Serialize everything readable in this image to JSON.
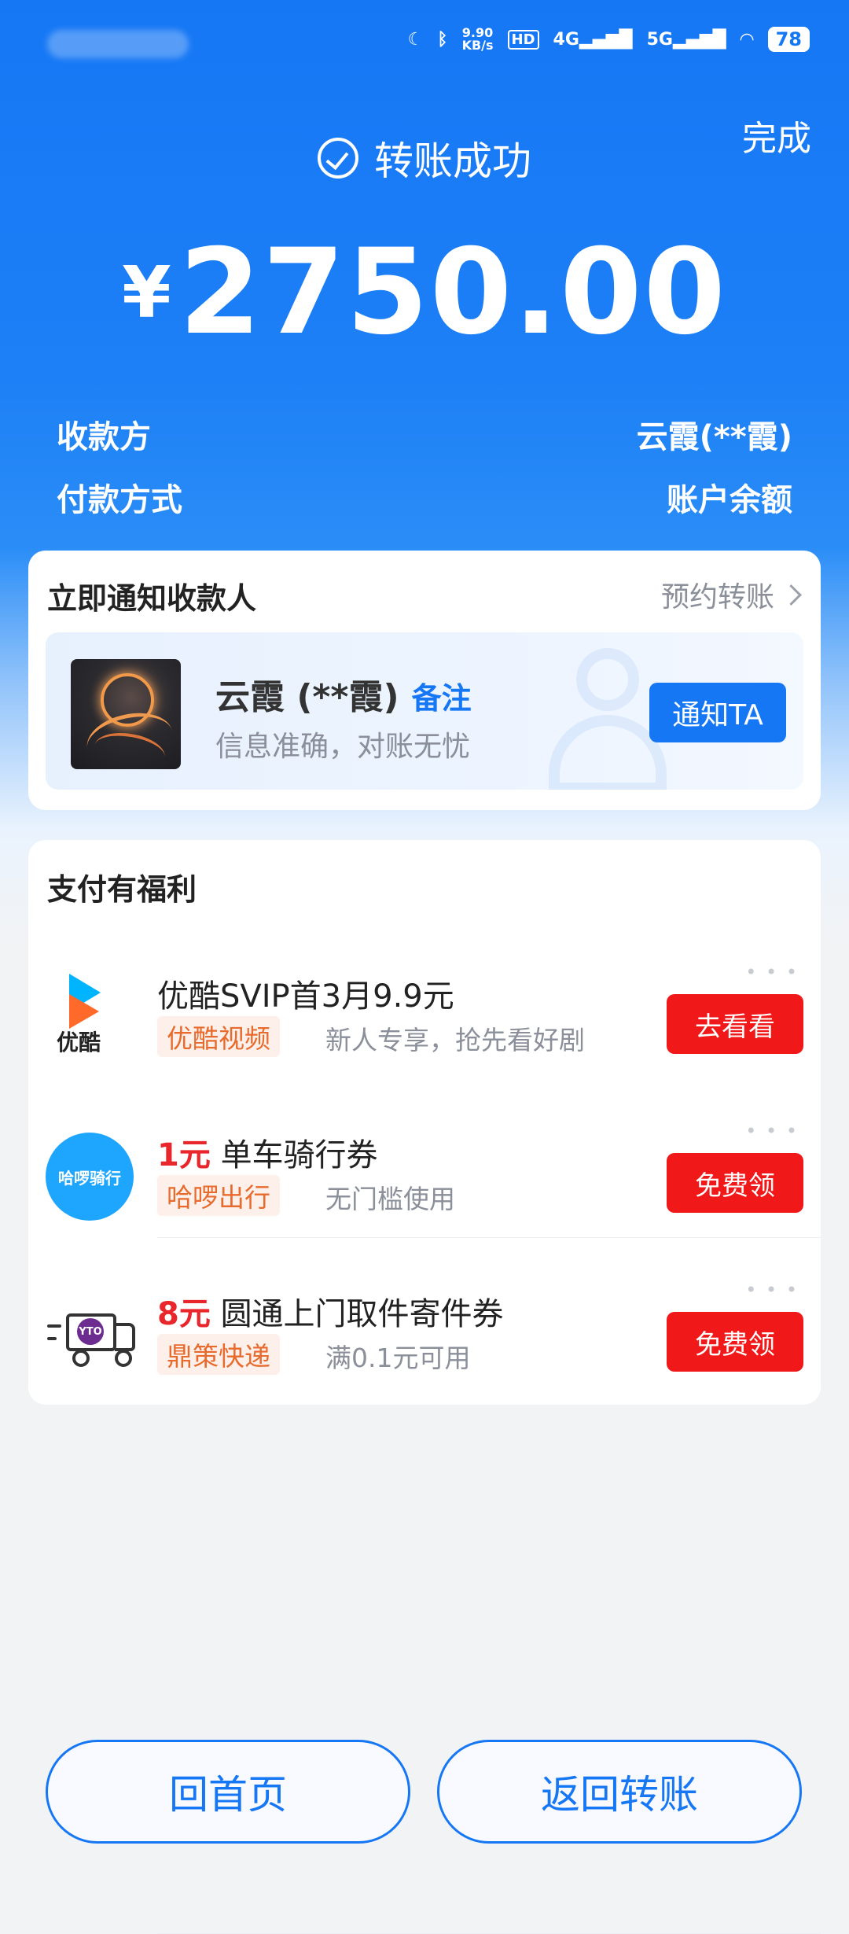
{
  "status_bar": {
    "net_speed": "9.90",
    "net_unit": "KB/s",
    "hd": "HD",
    "sig1": "4G",
    "sig2": "5G",
    "battery": "78"
  },
  "header": {
    "done_label": "完成",
    "status_text": "转账成功"
  },
  "amount": {
    "currency": "¥",
    "value": "2750.00"
  },
  "details": {
    "payee_label": "收款方",
    "payee_value": "云霞(**霞)",
    "method_label": "付款方式",
    "method_value": "账户余额"
  },
  "notify_card": {
    "title": "立即通知收款人",
    "reserve_label": "预约转账",
    "payee_name": "云霞 (**霞)",
    "note_label": "备注",
    "subtitle": "信息准确，对账无忧",
    "button": "通知TA"
  },
  "benefits": {
    "title": "支付有福利",
    "offers": [
      {
        "title_hl": "",
        "title": "优酷SVIP首3月9.9元",
        "tag": "优酷视频",
        "desc": "新人专享，抢先看好剧",
        "button": "去看看",
        "logo": "youku-logo",
        "logo_text": "优酷"
      },
      {
        "title_hl": "1元",
        "title": "单车骑行券",
        "tag": "哈啰出行",
        "desc": "无门槛使用",
        "button": "免费领",
        "logo": "hellobike-logo",
        "logo_text": "哈啰骑行"
      },
      {
        "title_hl": "8元",
        "title": "圆通上门取件寄件券",
        "tag": "鼎策快递",
        "desc": "满0.1元可用",
        "button": "免费领",
        "logo": "yto-truck-logo",
        "logo_text": "YTO"
      }
    ]
  },
  "bottom": {
    "home_label": "回首页",
    "back_label": "返回转账"
  },
  "colors": {
    "primary": "#1677f5",
    "danger": "#f01818",
    "tag_text": "#e86a2c"
  }
}
